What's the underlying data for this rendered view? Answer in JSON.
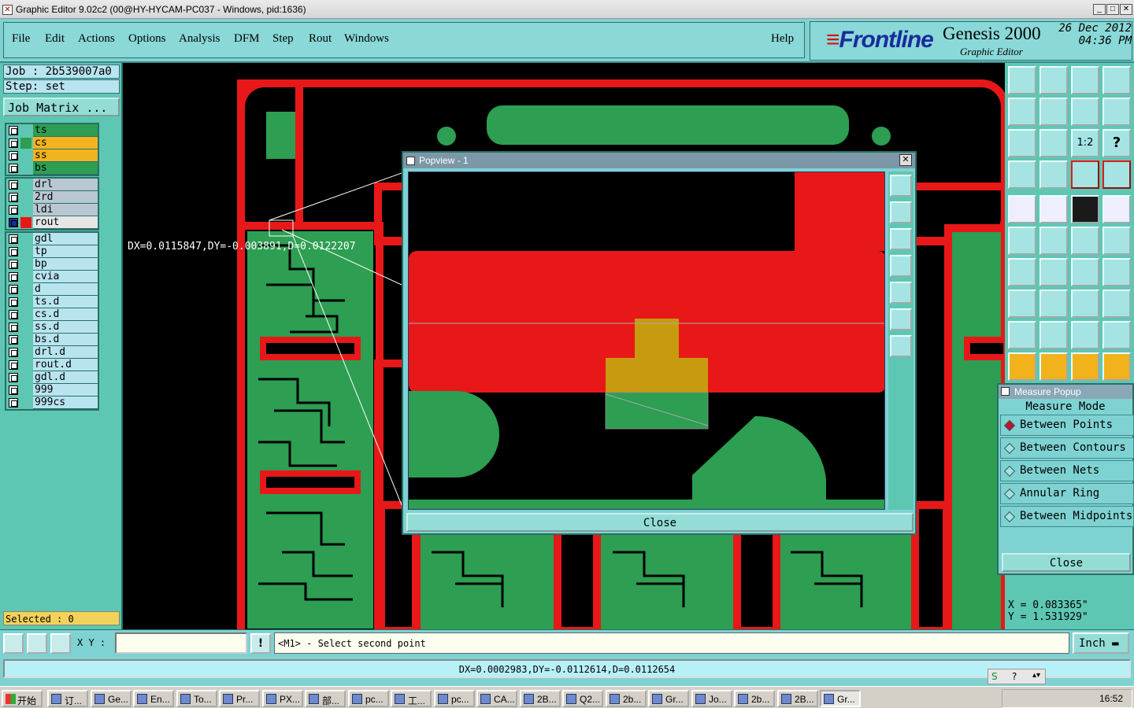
{
  "window": {
    "title": "Graphic Editor 9.02c2 (00@HY-HYCAM-PC037 - Windows, pid:1636)"
  },
  "menu": {
    "items": [
      "File",
      "Edit",
      "Actions",
      "Options",
      "Analysis",
      "DFM",
      "Step",
      "Rout",
      "Windows"
    ],
    "help": "Help"
  },
  "brand": {
    "logo": "Frontline",
    "product": "Genesis 2000",
    "subtitle": "Graphic Editor",
    "date": "26 Dec 2012",
    "time": "04:36 PM"
  },
  "job": {
    "job_line": "Job : 2b539007a0",
    "step_line": "Step: set",
    "matrix_button": "Job Matrix ..."
  },
  "layers": {
    "group1": [
      {
        "name": "ts",
        "color": "#2d9e52"
      },
      {
        "name": "cs",
        "color": "#f2b41e"
      },
      {
        "name": "ss",
        "color": "#f2b41e"
      },
      {
        "name": "bs",
        "color": "#2d9e52"
      }
    ],
    "group2": [
      {
        "name": "drl",
        "color": "#b9c7d3"
      },
      {
        "name": "2rd",
        "color": "#b9c7d3"
      },
      {
        "name": "ldi",
        "color": "#b9c7d3"
      },
      {
        "name": "rout",
        "color": "#e6e6e6"
      }
    ],
    "group3": [
      "gdl",
      "tp",
      "bp",
      "cvia",
      "d",
      "ts.d",
      "cs.d",
      "ss.d",
      "bs.d",
      "drl.d",
      "rout.d",
      "gdl.d",
      "999",
      "999cs"
    ]
  },
  "selected": "Selected : 0",
  "canvas": {
    "measure_readout": "DX=0.0115847,DY=-0.003891,D=0.0122207"
  },
  "popview": {
    "title": "Popview - 1",
    "close_label": "Close"
  },
  "measure_popup": {
    "title": "Measure Popup",
    "mode_label": "Measure Mode",
    "options": [
      "Between Points",
      "Between Contours",
      "Between Nets",
      "Annular Ring",
      "Between Midpoints"
    ],
    "selected_option": "Between Points",
    "close_label": "Close"
  },
  "coords": {
    "x": "X = 0.083365\"",
    "y": "Y = 1.531929\""
  },
  "command": {
    "xy_label": "X Y :",
    "xy_value": "",
    "prompt": "<M1> - Select second point",
    "units": "Inch"
  },
  "status": {
    "measurement": "DX=0.0002983,DY=-0.0112614,D=0.0112654"
  },
  "taskbar": {
    "start_label": "开始",
    "tasks": [
      "订...",
      "Ge...",
      "En...",
      "To...",
      "Pr...",
      "PX...",
      "部...",
      "pc...",
      "工...",
      "pc...",
      "CA...",
      "2B...",
      "Q2...",
      "2b...",
      "Gr...",
      "Jo...",
      "2b...",
      "2B...",
      "Gr..."
    ],
    "clock": "16:52"
  },
  "colors": {
    "layer_green": "#2d9e52",
    "rout_red": "#e81818",
    "panel_teal": "#5ec7b3",
    "copper_orange": "#c89a10"
  }
}
